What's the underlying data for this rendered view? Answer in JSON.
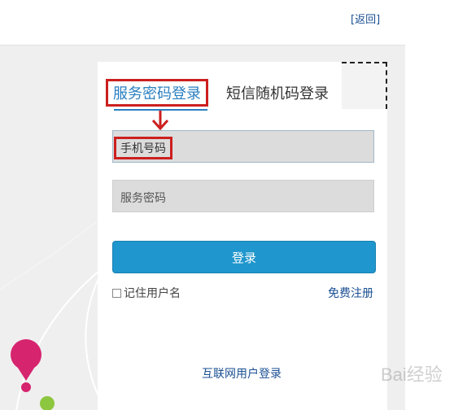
{
  "header": {
    "back_label": "[返回]"
  },
  "tabs": {
    "password_login": "服务密码登录",
    "sms_login": "短信随机码登录"
  },
  "form": {
    "phone_placeholder": "手机号码",
    "password_placeholder": "服务密码",
    "login_button": "登录",
    "remember_label": "记住用户名",
    "register_link": "免费注册",
    "internet_user_login": "互联网用户登录"
  },
  "watermark": {
    "text": "Bai经验"
  },
  "colors": {
    "accent": "#2a7fc0",
    "button": "#1f96cd",
    "highlight": "#cc1f1f",
    "link": "#1a4f93",
    "pin": "#d6246f",
    "dot": "#8dc63f"
  }
}
